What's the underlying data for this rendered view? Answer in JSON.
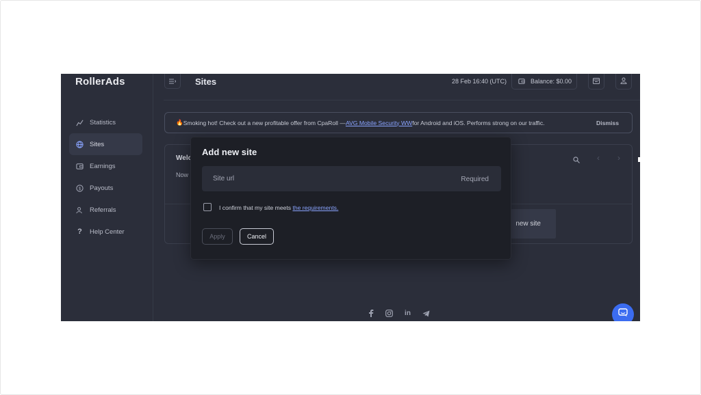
{
  "app": {
    "logo": "RollerAds",
    "page_title": "Sites",
    "datetime": "28 Feb 16:40 (UTC)",
    "balance": "Balance: $0.00"
  },
  "sidebar": {
    "items": [
      {
        "label": "Statistics",
        "icon": "chart-icon"
      },
      {
        "label": "Sites",
        "icon": "globe-icon",
        "active": true
      },
      {
        "label": "Earnings",
        "icon": "wallet-icon"
      },
      {
        "label": "Payouts",
        "icon": "coin-icon"
      },
      {
        "label": "Referrals",
        "icon": "users-icon"
      },
      {
        "label": "Help Center",
        "icon": "help-icon"
      }
    ]
  },
  "banner": {
    "emoji": "🔥",
    "text_before": "Smoking hot! Check out a new profitable offer from CpaRoll — ",
    "link_text": "AVG Mobile Security WW",
    "text_after": " for Android and iOS. Performs strong on our traffic.",
    "dismiss": "Dismiss"
  },
  "card": {
    "title_visible": "Welc",
    "text_visible": "Now i",
    "add_site_visible": "new site"
  },
  "modal": {
    "title": "Add new site",
    "site_url_placeholder": "Site url",
    "site_url_value": "",
    "required": "Required",
    "confirm_text": "I confirm that my site meets ",
    "requirements_link": "the requirements.",
    "confirm_checked": false,
    "apply": "Apply",
    "cancel": "Cancel"
  },
  "footer": {
    "icons": [
      "facebook-icon",
      "instagram-icon",
      "linkedin-icon",
      "telegram-icon"
    ]
  },
  "colors": {
    "background": "#2b2e3a",
    "modal": "#1d1f26",
    "accent_link": "#8aa4ff",
    "chat_button": "#3b6cf0"
  }
}
